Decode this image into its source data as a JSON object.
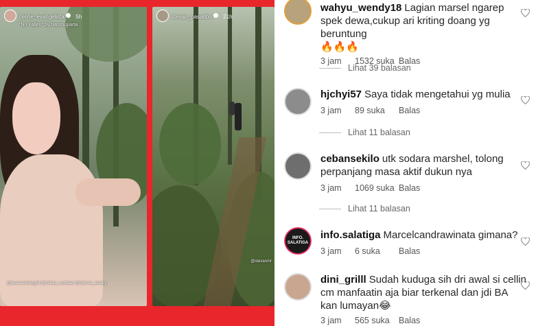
{
  "stories": {
    "left": {
      "username": "celine_evangelista",
      "time": "5h",
      "music": "\"No Fallen\" by harusugiarta",
      "tags": "@anessumiang13 @raihan_sumbarr @marvel_ashary"
    },
    "right": {
      "username": "stevan_pasaribu",
      "time": "21h",
      "watermark": "@stevanmr"
    }
  },
  "comments": [
    {
      "username": "wahyu_wendy18",
      "text": "Lagian marsel ngarep spek dewa,cukup ari kriting doang yg beruntung",
      "emoji": "🔥🔥🔥",
      "time": "3 jam",
      "likes": "1532 suka",
      "reply": "Balas",
      "view_replies": "Lihat 39 balasan",
      "avatar_color": "#b7a27c"
    },
    {
      "username": "hjchyi57",
      "text": "Saya tidak mengetahui yg mulia",
      "time": "3 jam",
      "likes": "89 suka",
      "reply": "Balas",
      "view_replies": "Lihat 11 balasan",
      "avatar_color": "#8c8c8c"
    },
    {
      "username": "cebansekilo",
      "text": "utk sodara marshel, tolong perpanjang masa aktif dukun nya",
      "time": "3 jam",
      "likes": "1069 suka",
      "reply": "Balas",
      "view_replies": "Lihat 11 balasan",
      "avatar_color": "#6e6e6e"
    },
    {
      "username": "info.salatiga",
      "text": "Marcelcandrawinata gimana?",
      "time": "3 jam",
      "likes": "6 suka",
      "reply": "Balas",
      "logo_text_1": "INFO.",
      "logo_text_2": "SALATIGA"
    },
    {
      "username": "dini_grilll",
      "text": "Sudah kuduga sih dri awal si cellin cm manfaatin aja biar terkenal dan jdi BA kan lumayan",
      "emoji": "😂",
      "time": "3 jam",
      "likes": "565 suka",
      "reply": "Balas",
      "avatar_color": "#c9a690"
    }
  ],
  "colors": {
    "collage_background": "#e8262b",
    "text": "#262626",
    "muted": "#555555"
  }
}
